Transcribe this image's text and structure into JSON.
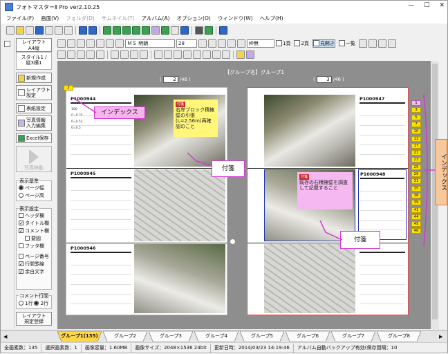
{
  "window": {
    "title": "フォトマスターⅡ Pro ver2.10.25",
    "controls": [
      "minimize",
      "maximize",
      "close"
    ]
  },
  "menu": [
    {
      "label": "ファイル(F)",
      "enabled": true
    },
    {
      "label": "画面(V)",
      "enabled": true
    },
    {
      "label": "フォルダ(D)",
      "enabled": false
    },
    {
      "label": "サムネイル(T)",
      "enabled": false
    },
    {
      "label": "アルバム(A)",
      "enabled": true
    },
    {
      "label": "オプション(O)",
      "enabled": true
    },
    {
      "label": "ウィンドウ(W)",
      "enabled": true
    },
    {
      "label": "ヘルプ(H)",
      "enabled": true
    }
  ],
  "format_toolbar": {
    "font_name": "ＭＳ 明朝",
    "font_size": "28",
    "border_select": "枠無",
    "view_1page": "1頁",
    "view_2page": "2頁",
    "view_spread": "見開き",
    "view_list": "一覧"
  },
  "left_panel": {
    "layout_btn": "レイアウト\nA4縦",
    "layout_info": "スタイル1 /\n縦3横1",
    "btn_new": "新規作成",
    "btn_layout_settings": "レイアウト\n設定",
    "btn_cover": "表紙設定",
    "btn_photo_info": "写真情報\n入力編集",
    "btn_excel": "Excel保存",
    "btn_move": "写真移動",
    "display_basis": {
      "title": "表示基準",
      "options": [
        {
          "label": "ページ幅",
          "selected": true
        },
        {
          "label": "ページ高",
          "selected": false
        }
      ]
    },
    "display_settings": {
      "title": "表示設定",
      "items": [
        {
          "label": "ヘッダ欄",
          "checked": false
        },
        {
          "label": "タイトル欄",
          "checked": true
        },
        {
          "label": "コメント欄",
          "checked": true
        },
        {
          "label": "要図",
          "checked": false
        },
        {
          "label": "フッタ欄",
          "checked": false
        },
        {
          "label": "ページ番号",
          "checked": false
        },
        {
          "label": "行間罫線",
          "checked": true
        },
        {
          "label": "余白文字",
          "checked": true
        }
      ]
    },
    "comment_lines": {
      "title": "コメント行間",
      "options": [
        {
          "label": "1行",
          "selected": false
        },
        {
          "label": "2行",
          "selected": true
        }
      ]
    },
    "btn_layout_register": "レイアウト\n規定登録"
  },
  "canvas": {
    "group_header": "【グループ名】グループ1",
    "left_page": {
      "current": "2",
      "total": "/46",
      "open": "(",
      "close": ")"
    },
    "right_page": {
      "current": "3",
      "total": "/46",
      "open": "(",
      "close": ")"
    },
    "left_photos": [
      {
        "id": "P1000944",
        "notes": [
          "100",
          "0=0.35",
          "0=0.52",
          "0=0.5"
        ]
      },
      {
        "id": "P1000945",
        "notes": []
      },
      {
        "id": "P1000946",
        "notes": []
      }
    ],
    "right_photos": [
      {
        "id": "P1000947"
      },
      {
        "id": "P1000948"
      },
      {
        "id": ""
      }
    ],
    "sticky_left": {
      "tag": "付箋",
      "text": "右岸ブロック積擁壁の引張(L=2.56m)再確認のこと"
    },
    "sticky_right": {
      "tag": "付箋",
      "text": "既存の石積擁壁を調査して記載すること"
    },
    "index_tabs_right": [
      "1",
      "3",
      "5",
      "7",
      "10",
      "13",
      "17",
      "21",
      "23",
      "25",
      "29",
      "31",
      "35",
      "38",
      "39",
      "41",
      "44",
      "45",
      "46"
    ],
    "index_tab_left": "2"
  },
  "annotations": {
    "index_label": "インデックス",
    "sticky_label_1": "付箋",
    "sticky_label_2": "付箋",
    "index_vertical": "インデックス"
  },
  "tabs": [
    {
      "label": "グループ1(135)",
      "active": true
    },
    {
      "label": "グループ2",
      "active": false
    },
    {
      "label": "グループ3",
      "active": false
    },
    {
      "label": "グループ4",
      "active": false
    },
    {
      "label": "グループ5",
      "active": false
    },
    {
      "label": "グループ6",
      "active": false
    },
    {
      "label": "グループ7",
      "active": false
    },
    {
      "label": "グループ8",
      "active": false
    }
  ],
  "status": {
    "total_photos": "全画素数：135",
    "selected": "選択画素数：1",
    "image_size": "画像容量：1.60MB",
    "dimensions": "画像サイズ：2048×1536 24bit",
    "updated": "更新日時：2014/03/23 14:19:46",
    "backup": "アルバム自動バックアップ有効(保存間隔：10"
  },
  "colors": {
    "sticky_yellow": "#fff67a",
    "sticky_pink": "#f5b8f0",
    "callout_pink": "#f6b4ee",
    "accent_magenta": "#d23ad2",
    "index_yellow": "#ffe100",
    "tab_yellow": "#ffd84a",
    "annot_peach": "#f7c89c"
  }
}
